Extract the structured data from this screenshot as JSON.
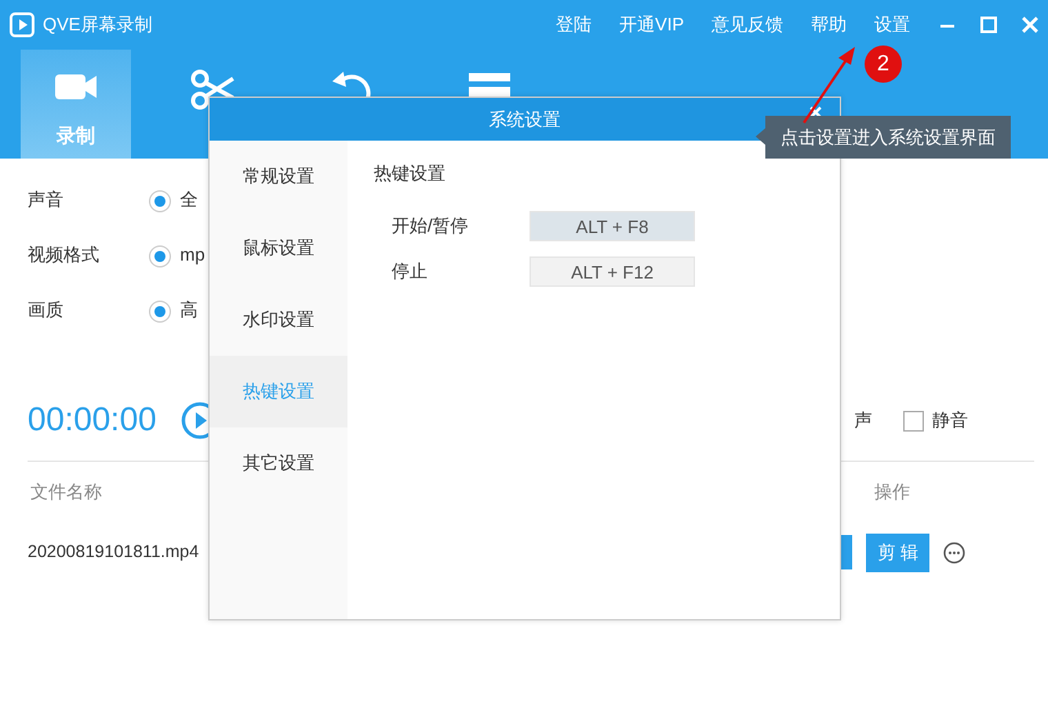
{
  "window": {
    "title": "QVE屏幕录制"
  },
  "menu": [
    "登陆",
    "开通VIP",
    "意见反馈",
    "帮助",
    "设置"
  ],
  "tabs": [
    {
      "label": "录制",
      "selected": true,
      "kind": "camera"
    },
    {
      "selected": false,
      "kind": "scissors"
    },
    {
      "selected": false,
      "kind": "undo"
    },
    {
      "selected": false,
      "kind": "screen"
    }
  ],
  "settings": [
    {
      "label": "声音",
      "option": "全",
      "checked": true
    },
    {
      "label": "视频格式",
      "option": "mp",
      "checked": true
    },
    {
      "label": "画质",
      "option": "高",
      "checked": true
    }
  ],
  "timer": "00:00:00",
  "audio_option": "声",
  "mute": {
    "label": "静音",
    "checked": false
  },
  "table": {
    "columns": [
      "文件名称",
      "操作"
    ],
    "rows": [
      {
        "name": "20200819101811.mp4",
        "actions": [
          "剪 辑"
        ]
      }
    ]
  },
  "dialog": {
    "title": "系统设置",
    "nav": [
      {
        "label": "常规设置",
        "selected": false
      },
      {
        "label": "鼠标设置",
        "selected": false
      },
      {
        "label": "水印设置",
        "selected": false
      },
      {
        "label": "热键设置",
        "selected": true
      },
      {
        "label": "其它设置",
        "selected": false
      }
    ],
    "section": "热键设置",
    "hotkeys": [
      {
        "label": "开始/暂停",
        "value": "ALT + F8",
        "selected": true
      },
      {
        "label": "停止",
        "value": "ALT + F12",
        "selected": false
      }
    ]
  },
  "annotation": {
    "badge": "2",
    "tooltip": "点击设置进入系统设置界面"
  }
}
